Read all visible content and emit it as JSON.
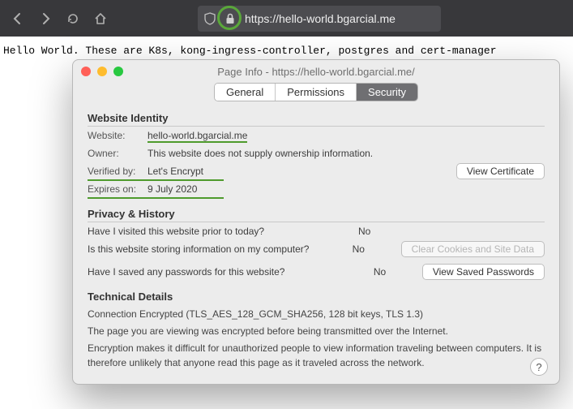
{
  "url": "https://hello-world.bgarcial.me",
  "page_text": "Hello World. These are K8s, kong-ingress-controller, postgres and cert-manager",
  "dialog": {
    "title": "Page Info - https://hello-world.bgarcial.me/",
    "tabs": {
      "general": "General",
      "permissions": "Permissions",
      "security": "Security"
    },
    "identity": {
      "head": "Website Identity",
      "website_k": "Website:",
      "website_v": "hello-world.bgarcial.me",
      "owner_k": "Owner:",
      "owner_v": "This website does not supply ownership information.",
      "verified_k": "Verified by:",
      "verified_v": "Let's Encrypt",
      "view_cert": "View Certificate",
      "expires_k": "Expires on:",
      "expires_v": "9 July 2020"
    },
    "privacy": {
      "head": "Privacy & History",
      "q_visited": "Have I visited this website prior to today?",
      "a_visited": "No",
      "q_storing": "Is this website storing information on my computer?",
      "a_storing": "No",
      "clear_btn": "Clear Cookies and Site Data",
      "q_passwords": "Have I saved any passwords for this website?",
      "a_passwords": "No",
      "view_pw_btn": "View Saved Passwords"
    },
    "tech": {
      "head": "Technical Details",
      "line1": "Connection Encrypted (TLS_AES_128_GCM_SHA256, 128 bit keys, TLS 1.3)",
      "line2": "The page you are viewing was encrypted before being transmitted over the Internet.",
      "line3": "Encryption makes it difficult for unauthorized people to view information traveling between computers. It is therefore unlikely that anyone read this page as it traveled across the network."
    },
    "help": "?"
  }
}
